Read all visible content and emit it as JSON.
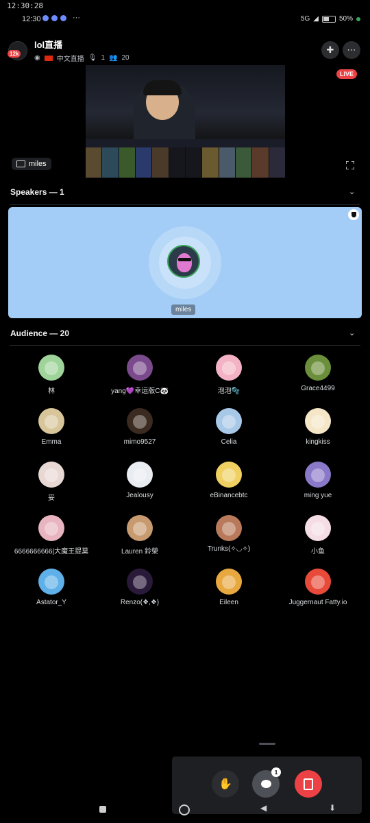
{
  "status_bar": {
    "clock_top": "12:30:28",
    "clock": "12:30",
    "more": "···",
    "signal_text": "5G",
    "battery": "50%"
  },
  "header": {
    "server_badge": "12k",
    "title": "lol直播",
    "tag": "中文直播",
    "speakers_count": "1",
    "listeners_count": "20"
  },
  "stream": {
    "live_label": "LIVE",
    "streamer": "miles"
  },
  "speakers": {
    "heading": "Speakers — 1",
    "items": [
      {
        "name": "miles"
      }
    ]
  },
  "audience": {
    "heading": "Audience — 20",
    "members": [
      {
        "name": "林",
        "color": "#9ed49a"
      },
      {
        "name": "yang💜幸运版C🐼",
        "color": "#7a4a8c"
      },
      {
        "name": "泡泡🫧",
        "color": "#f3b3c4"
      },
      {
        "name": "Grace4499",
        "color": "#6b8f3a"
      },
      {
        "name": "Emma",
        "color": "#d8c69a"
      },
      {
        "name": "mimo9527",
        "color": "#3a2a20"
      },
      {
        "name": "Celia",
        "color": "#a8c8e8"
      },
      {
        "name": "kingkiss",
        "color": "#f5e6c8"
      },
      {
        "name": "妥",
        "color": "#e8d8d4"
      },
      {
        "name": "Jealousy",
        "color": "#e9ecf0"
      },
      {
        "name": "eBinancebtc",
        "color": "#f0d060"
      },
      {
        "name": "ming yue",
        "color": "#8a78c8"
      },
      {
        "name": "6666666666|大魔王提莫",
        "color": "#e8b4c0"
      },
      {
        "name": "Lauren 鈴榮",
        "color": "#c89a70"
      },
      {
        "name": "Trunks(✧◡✧)",
        "color": "#b87a5a"
      },
      {
        "name": "小鱼",
        "color": "#f5dde6"
      },
      {
        "name": "Astator_Y",
        "color": "#5fb0e8"
      },
      {
        "name": "Renzo(❖,❖)",
        "color": "#2a1a3a"
      },
      {
        "name": "Eileen",
        "color": "#e8a840"
      },
      {
        "name": "Juggernaut Fatty.io",
        "color": "#e84a3a"
      }
    ]
  },
  "controls": {
    "chat_badge": "1"
  },
  "colors": {
    "accent_red": "#ed4245",
    "speaker_card": "#a3cdf7",
    "speaking_ring": "#3ba55d"
  }
}
